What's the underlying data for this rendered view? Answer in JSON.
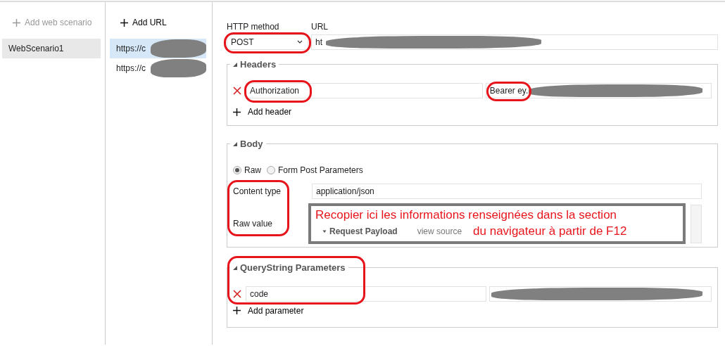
{
  "scenarios": {
    "add_label": "Add web scenario",
    "items": [
      {
        "name": "WebScenario1",
        "selected": true
      }
    ]
  },
  "urls": {
    "add_label": "Add URL",
    "items": [
      {
        "text": "https://c",
        "selected": true
      },
      {
        "text": "https://c",
        "selected": false
      }
    ]
  },
  "request": {
    "method_label": "HTTP method",
    "method": "POST",
    "url_label": "URL",
    "url_value": "ht"
  },
  "headers": {
    "title": "Headers",
    "rows": [
      {
        "name": "Authorization",
        "value": "Bearer ey."
      }
    ],
    "add_label": "Add header"
  },
  "body": {
    "title": "Body",
    "modes": [
      {
        "label": "Raw",
        "selected": true
      },
      {
        "label": "Form Post Parameters",
        "selected": false
      }
    ],
    "content_type_label": "Content type",
    "content_type": "application/json",
    "raw_value_label": "Raw value"
  },
  "query": {
    "title": "QueryString Parameters",
    "rows": [
      {
        "name": "code"
      }
    ],
    "add_label": "Add parameter"
  },
  "annotation": {
    "line_1": "Recopier ici les informations renseignées dans la section",
    "line_2": "du navigateur à partir de F12",
    "inset_title": "Request Payload",
    "inset_link": "view source"
  }
}
